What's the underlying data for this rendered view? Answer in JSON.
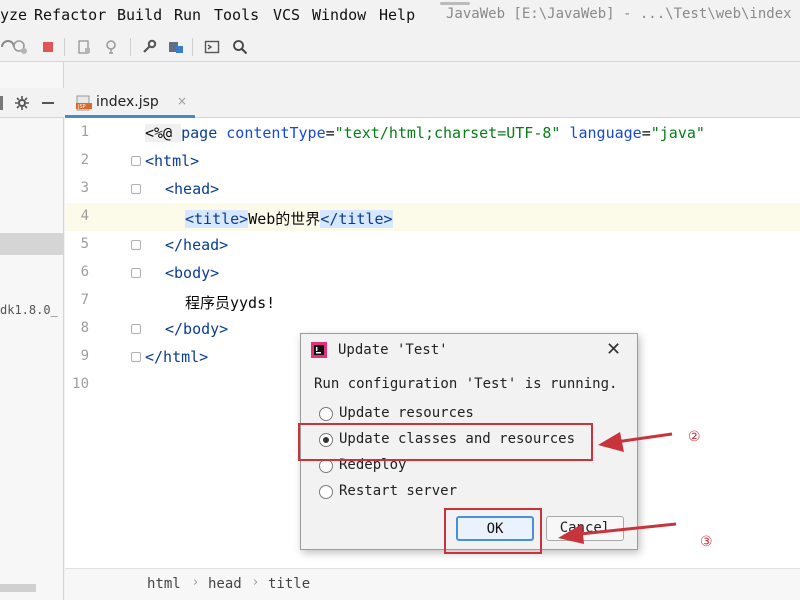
{
  "menu": {
    "items": [
      "yze",
      "Refactor",
      "Build",
      "Run",
      "Tools",
      "VCS",
      "Window",
      "Help"
    ],
    "window_title": "JavaWeb [E:\\JavaWeb] - ...\\Test\\web\\index"
  },
  "toolbar": {
    "icons": [
      "debug-coverage-icon",
      "profile-icon",
      "stop-icon",
      "build-artifact-icon",
      "attach-icon",
      "settings-icon",
      "project-structure-icon",
      "run-window-icon",
      "search-icon"
    ]
  },
  "project": {
    "jdk_label": "dk1.8.0_"
  },
  "tabs": [
    {
      "label": "index.jsp",
      "close": "×"
    }
  ],
  "editor": {
    "line_numbers": [
      "1",
      "2",
      "3",
      "4",
      "5",
      "6",
      "7",
      "8",
      "9",
      "10"
    ],
    "current_line": 4,
    "lines": {
      "l1": {
        "open": "<%@ ",
        "kw": "page",
        "attr1": "contentType",
        "eq1": "=",
        "val1": "\"text/html;charset=UTF-8\"",
        "attr2": "language",
        "eq2": "=",
        "val2": "\"java\""
      },
      "l2": {
        "tag": "<html>"
      },
      "l3": {
        "tag": "<head>"
      },
      "l4": {
        "open": "<title>",
        "text": "Web的世界",
        "close": "</title>"
      },
      "l5": {
        "tag": "</head>"
      },
      "l6": {
        "tag": "<body>"
      },
      "l7": {
        "text": "程序员yyds!"
      },
      "l8": {
        "tag": "</body>"
      },
      "l9": {
        "tag": "</html>"
      }
    }
  },
  "breadcrumb": [
    "html",
    "head",
    "title"
  ],
  "dialog": {
    "title": "Update 'Test'",
    "close": "✕",
    "message": "Run configuration 'Test' is running.",
    "options": [
      {
        "label": "Update resources",
        "selected": false
      },
      {
        "label": "Update classes and resources",
        "selected": true
      },
      {
        "label": "Redeploy",
        "selected": false
      },
      {
        "label": "Restart server",
        "selected": false
      }
    ],
    "ok_label": "OK",
    "cancel_label": "Cancel"
  },
  "annotations": {
    "step2": "②",
    "step3": "③",
    "color": "#c8343c"
  },
  "colors": {
    "accent": "#4a88c7",
    "tag": "#0a3d91",
    "string": "#067d17",
    "stop": "#e05555"
  }
}
